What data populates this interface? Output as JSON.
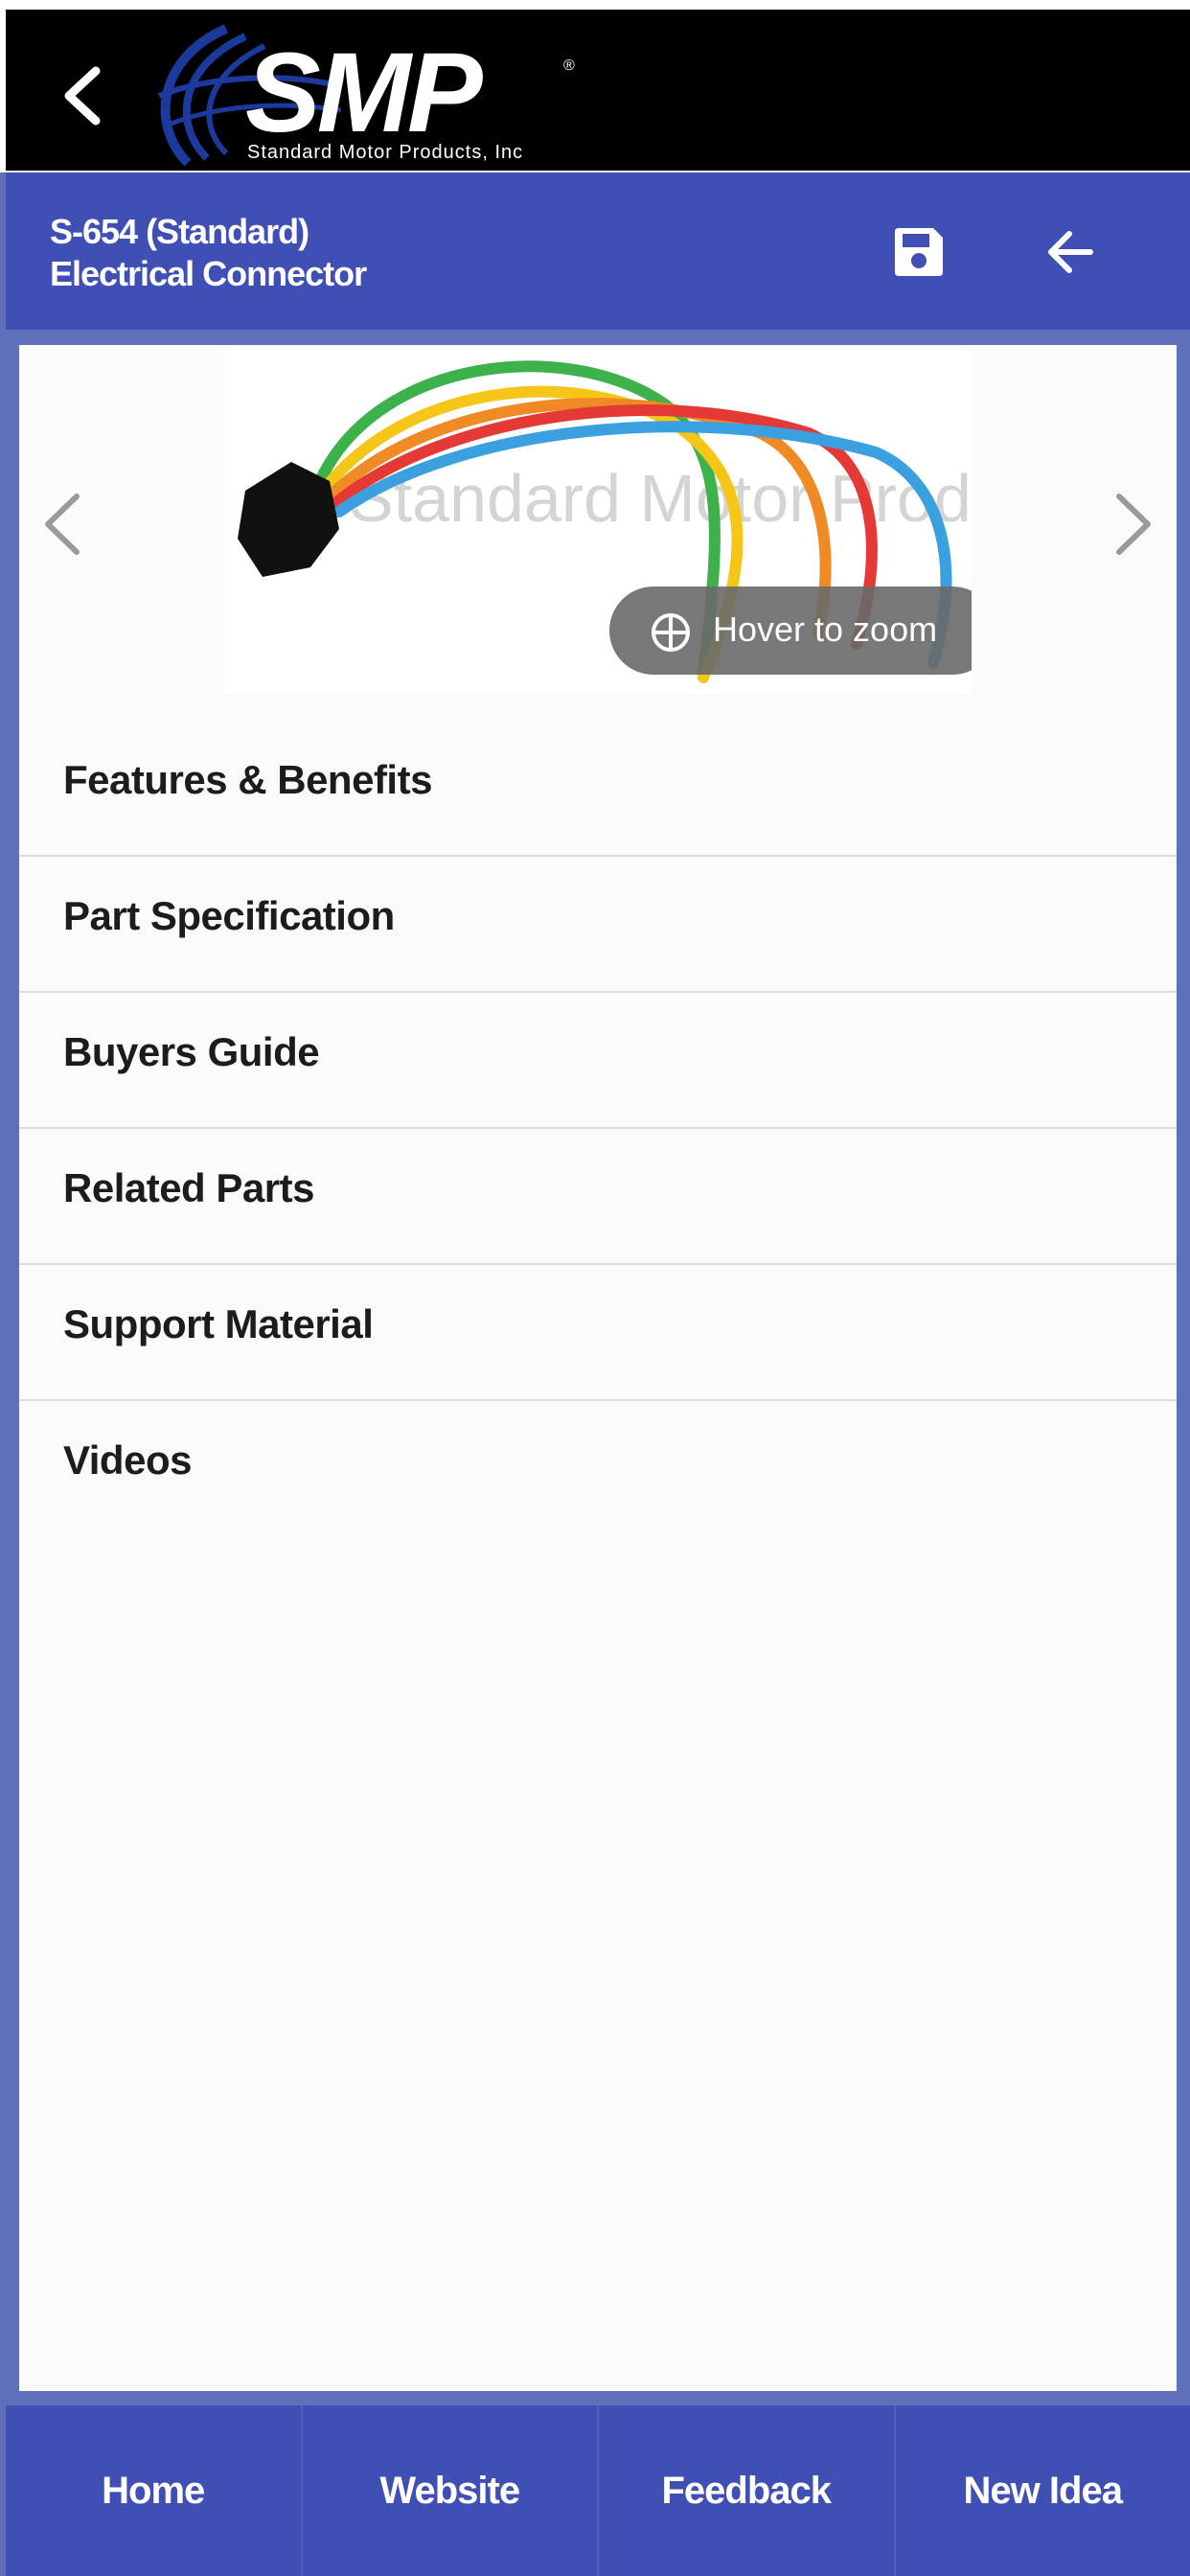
{
  "logo": {
    "word": "SMP",
    "registered": "®",
    "subtitle": "Standard Motor Products, Inc"
  },
  "header": {
    "title_line1": "S-654 (Standard)",
    "title_line2": "Electrical Connector"
  },
  "product_image": {
    "watermark": "Standard Motor Prod",
    "zoom_label": "Hover to zoom",
    "wire_colors": [
      "#3db14a",
      "#f5c518",
      "#f08a24",
      "#e53935",
      "#3aa0e0"
    ]
  },
  "menu": {
    "items": [
      {
        "label": "Features & Benefits"
      },
      {
        "label": "Part Specification"
      },
      {
        "label": "Buyers Guide"
      },
      {
        "label": "Related Parts"
      },
      {
        "label": "Support Material"
      },
      {
        "label": "Videos"
      }
    ]
  },
  "bottom_nav": {
    "tabs": [
      {
        "label": "Home"
      },
      {
        "label": "Website"
      },
      {
        "label": "Feedback"
      },
      {
        "label": "New Idea"
      }
    ]
  },
  "colors": {
    "header_bg": "#3f4fb4",
    "topbar_bg": "#000000",
    "page_bg": "#5f6fba"
  }
}
